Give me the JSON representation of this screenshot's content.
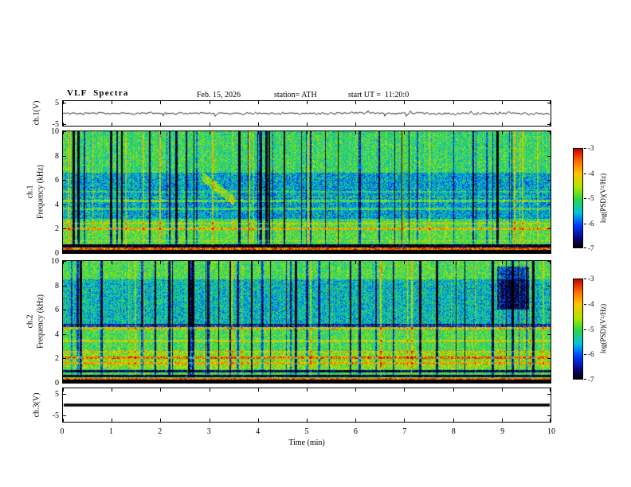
{
  "header": {
    "title": "VLF  Spectra",
    "date": "Feb. 15, 2026",
    "station": "station= ATH",
    "start_ut": "start UT =  11:20:0"
  },
  "axes": {
    "x_label": "Time (min)",
    "x_ticks": [
      "0",
      "1",
      "2",
      "3",
      "4",
      "5",
      "6",
      "7",
      "8",
      "9",
      "10"
    ],
    "x_range_min": [
      0,
      10
    ]
  },
  "colorbar": {
    "label": "log(PSD)(V²/Hz)",
    "ticks": [
      "-3",
      "-4",
      "-5",
      "-6",
      "-7"
    ],
    "range": [
      -7,
      -3
    ],
    "stops": [
      {
        "v": -7.0,
        "c": [
          0,
          0,
          0
        ]
      },
      {
        "v": -6.6,
        "c": [
          8,
          8,
          130
        ]
      },
      {
        "v": -6.1,
        "c": [
          0,
          60,
          255
        ]
      },
      {
        "v": -5.6,
        "c": [
          0,
          195,
          225
        ]
      },
      {
        "v": -5.05,
        "c": [
          45,
          215,
          65
        ]
      },
      {
        "v": -4.55,
        "c": [
          175,
          230,
          0
        ]
      },
      {
        "v": -4.0,
        "c": [
          255,
          195,
          0
        ]
      },
      {
        "v": -3.5,
        "c": [
          255,
          105,
          0
        ]
      },
      {
        "v": -3.0,
        "c": [
          195,
          0,
          0
        ]
      }
    ]
  },
  "chart_data": [
    {
      "id": "ch1-waveform",
      "type": "line",
      "ylabel": "ch.1(V)",
      "ylim": [
        -5,
        5
      ],
      "yticks": [
        "5",
        "-5"
      ],
      "x_range_min": [
        0,
        10
      ],
      "description": "broadband noise trace centered on 0 V, about ±1 V, sporadic spikes to ±3 V",
      "gen": {
        "seed": 20260215,
        "amp": 1.05,
        "smooth": 0.45,
        "spike_prob": 0.015,
        "spike_amp": 2.2
      }
    },
    {
      "id": "ch1-spectrogram",
      "type": "heatmap",
      "ylabel_outer": "ch.1",
      "ylabel_inner": "Frequency (kHz)",
      "ylim": [
        0,
        10
      ],
      "yticks": [
        "10",
        "8",
        "6",
        "4",
        "2",
        "0"
      ],
      "clim": [
        -7,
        -3
      ],
      "x_range_min": [
        0,
        10
      ],
      "description": "speckled green/cyan background, bluer 3-6.5 kHz band, dense dark-blue vertical sferic streaks, red line near 0.3 kHz, black bands at 0 and ~0.5 kHz, bright lines near 2, 2.4, 3.6, 4.3, 5 kHz, faint descending arc near 3 min",
      "gen": {
        "seed": 1111,
        "base": -5.1,
        "noise": 1.25,
        "dark_streak_prob": 0.085,
        "bright_streak_prob": 0.028,
        "base_bands": [
          {
            "f0": 2.8,
            "f1": 6.6,
            "delta": -0.55
          },
          {
            "f0": 0.3,
            "f1": 2.6,
            "delta": 0.15
          }
        ],
        "lines": [
          {
            "f0": 0.0,
            "f1": 0.22,
            "delta": -3.0
          },
          {
            "f0": 0.24,
            "f1": 0.4,
            "delta": 1.55
          },
          {
            "f0": 0.45,
            "f1": 0.7,
            "delta": -2.2
          },
          {
            "f0": 0.95,
            "f1": 1.05,
            "delta": 0.5
          },
          {
            "f0": 1.9,
            "f1": 2.1,
            "delta": 1.0
          },
          {
            "f0": 2.35,
            "f1": 2.5,
            "delta": 0.7
          },
          {
            "f0": 3.55,
            "f1": 3.75,
            "delta": 0.55
          },
          {
            "f0": 4.2,
            "f1": 4.4,
            "delta": 0.75
          },
          {
            "f0": 4.55,
            "f1": 4.65,
            "delta": 0.5
          },
          {
            "f0": 5.0,
            "f1": 5.1,
            "delta": 0.45
          }
        ],
        "arc": {
          "x0": 0.285,
          "x1": 0.35,
          "f0": 6.3,
          "f1": 4.3,
          "width": 0.4,
          "delta": 0.9
        },
        "patches": []
      }
    },
    {
      "id": "ch2-spectrogram",
      "type": "heatmap",
      "ylabel_outer": "ch.2",
      "ylabel_inner": "Frequency (kHz)",
      "ylim": [
        0,
        10
      ],
      "yticks": [
        "10",
        "8",
        "6",
        "4",
        "2",
        "0"
      ],
      "clim": [
        -7,
        -3
      ],
      "x_range_min": [
        0,
        10
      ],
      "description": "green speckled background, bluer 5-8.5 kHz band with dark vertical streaks, orange/red lines near 0.3, 1.6, 2.05, 4.5 kHz, dark bands near 0.5, 0.9, 4.7 kHz, black band at 0 kHz, dark patch near 9 min above 6 kHz",
      "gen": {
        "seed": 2222,
        "base": -5.0,
        "noise": 1.25,
        "dark_streak_prob": 0.08,
        "bright_streak_prob": 0.03,
        "base_bands": [
          {
            "f0": 4.8,
            "f1": 8.5,
            "delta": -0.5
          },
          {
            "f0": 1.1,
            "f1": 2.6,
            "delta": 0.3
          }
        ],
        "lines": [
          {
            "f0": 0.0,
            "f1": 0.22,
            "delta": -3.0
          },
          {
            "f0": 0.24,
            "f1": 0.38,
            "delta": 1.5
          },
          {
            "f0": 0.45,
            "f1": 0.6,
            "delta": -2.0
          },
          {
            "f0": 0.8,
            "f1": 1.0,
            "delta": -1.8
          },
          {
            "f0": 1.5,
            "f1": 1.65,
            "delta": 0.8
          },
          {
            "f0": 1.95,
            "f1": 2.15,
            "delta": 1.2
          },
          {
            "f0": 2.5,
            "f1": 2.6,
            "delta": 0.6
          },
          {
            "f0": 3.35,
            "f1": 3.5,
            "delta": 0.6
          },
          {
            "f0": 4.4,
            "f1": 4.55,
            "delta": 1.0
          },
          {
            "f0": 4.6,
            "f1": 4.85,
            "delta": -1.2
          }
        ],
        "patches": [
          {
            "x0": 0.89,
            "x1": 0.955,
            "f0": 6.0,
            "f1": 9.6,
            "delta": -1.3
          }
        ]
      }
    },
    {
      "id": "ch3-waveform",
      "type": "line",
      "ylabel": "ch.3(V)",
      "ylim": [
        -5,
        5
      ],
      "yticks": [
        "5",
        "-5"
      ],
      "x_range_min": [
        0,
        10
      ],
      "constant_value": 0,
      "description": "flat thick line at 0 V (channel inactive)"
    }
  ]
}
